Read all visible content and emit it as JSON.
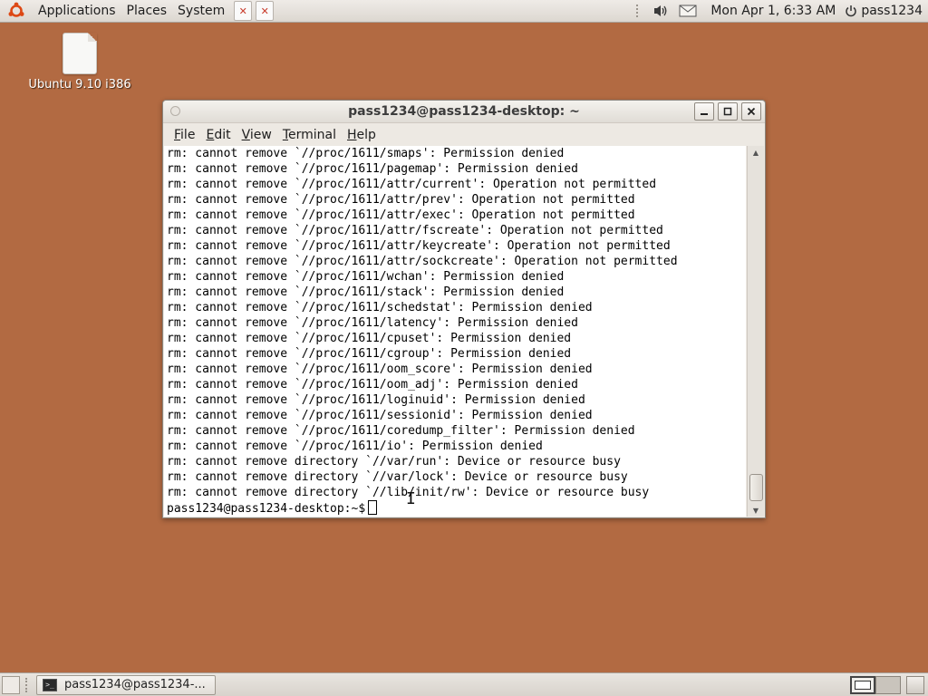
{
  "top_panel": {
    "menus": [
      "Applications",
      "Places",
      "System"
    ],
    "clock": "Mon Apr  1,  6:33 AM",
    "user": "pass1234"
  },
  "desktop": {
    "icon_label": "Ubuntu 9.10 i386"
  },
  "terminal": {
    "title": "pass1234@pass1234-desktop: ~",
    "menu": [
      "File",
      "Edit",
      "View",
      "Terminal",
      "Help"
    ],
    "lines": [
      "rm: cannot remove `//proc/1611/smaps': Permission denied",
      "rm: cannot remove `//proc/1611/pagemap': Permission denied",
      "rm: cannot remove `//proc/1611/attr/current': Operation not permitted",
      "rm: cannot remove `//proc/1611/attr/prev': Operation not permitted",
      "rm: cannot remove `//proc/1611/attr/exec': Operation not permitted",
      "rm: cannot remove `//proc/1611/attr/fscreate': Operation not permitted",
      "rm: cannot remove `//proc/1611/attr/keycreate': Operation not permitted",
      "rm: cannot remove `//proc/1611/attr/sockcreate': Operation not permitted",
      "rm: cannot remove `//proc/1611/wchan': Permission denied",
      "rm: cannot remove `//proc/1611/stack': Permission denied",
      "rm: cannot remove `//proc/1611/schedstat': Permission denied",
      "rm: cannot remove `//proc/1611/latency': Permission denied",
      "rm: cannot remove `//proc/1611/cpuset': Permission denied",
      "rm: cannot remove `//proc/1611/cgroup': Permission denied",
      "rm: cannot remove `//proc/1611/oom_score': Permission denied",
      "rm: cannot remove `//proc/1611/oom_adj': Permission denied",
      "rm: cannot remove `//proc/1611/loginuid': Permission denied",
      "rm: cannot remove `//proc/1611/sessionid': Permission denied",
      "rm: cannot remove `//proc/1611/coredump_filter': Permission denied",
      "rm: cannot remove `//proc/1611/io': Permission denied",
      "rm: cannot remove directory `//var/run': Device or resource busy",
      "rm: cannot remove directory `//var/lock': Device or resource busy",
      "rm: cannot remove directory `//lib/init/rw': Device or resource busy"
    ],
    "prompt": "pass1234@pass1234-desktop:~$"
  },
  "taskbar": {
    "task_label": "pass1234@pass1234-..."
  },
  "colors": {
    "desktop_background": "#b26a42",
    "panel": "#e4e0da",
    "terminal_background": "#ffffff"
  },
  "icons": {
    "logo": "ubuntu-logo-icon",
    "volume": "speaker-icon",
    "mail": "envelope-icon",
    "power": "power-icon",
    "terminal": "terminal-icon"
  }
}
